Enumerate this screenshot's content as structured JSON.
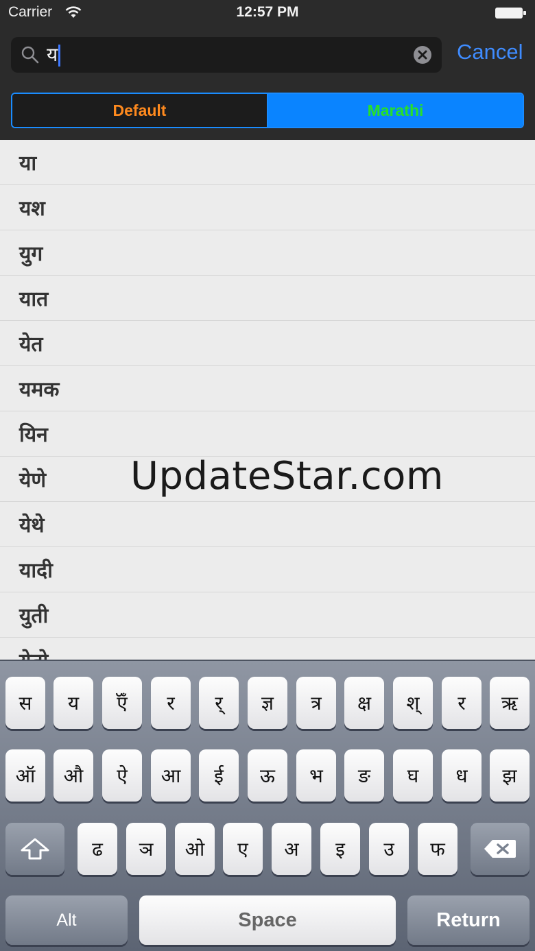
{
  "status_bar": {
    "carrier": "Carrier",
    "time": "12:57 PM"
  },
  "search": {
    "query": "य",
    "cancel_label": "Cancel"
  },
  "segments": [
    {
      "label": "Default",
      "selected": false
    },
    {
      "label": "Marathi",
      "selected": true
    }
  ],
  "results": [
    "या",
    "यश",
    "युग",
    "यात",
    "येत",
    "यमक",
    "यिन",
    "येणे",
    "येथे",
    "यादी",
    "युती",
    "येतो"
  ],
  "watermark": "UpdateStar.com",
  "keyboard": {
    "row1": [
      "स",
      "य",
      "ऍँ",
      "र",
      "र्",
      "ज्ञ",
      "त्र",
      "क्ष",
      "श्",
      "र",
      "ऋ"
    ],
    "row2": [
      "ऑ",
      "औ",
      "ऐ",
      "आ",
      "ई",
      "ऊ",
      "भ",
      "ङ",
      "घ",
      "ध",
      "झ"
    ],
    "row3": [
      "ढ",
      "ञ",
      "ओ",
      "ए",
      "अ",
      "इ",
      "उ",
      "फ"
    ],
    "alt_label": "Alt",
    "space_label": "Space",
    "return_label": "Return"
  },
  "colors": {
    "accent": "#0a84ff",
    "default_text": "#ff8a1e",
    "marathi_text": "#28e02a",
    "cancel": "#3f8cff"
  }
}
